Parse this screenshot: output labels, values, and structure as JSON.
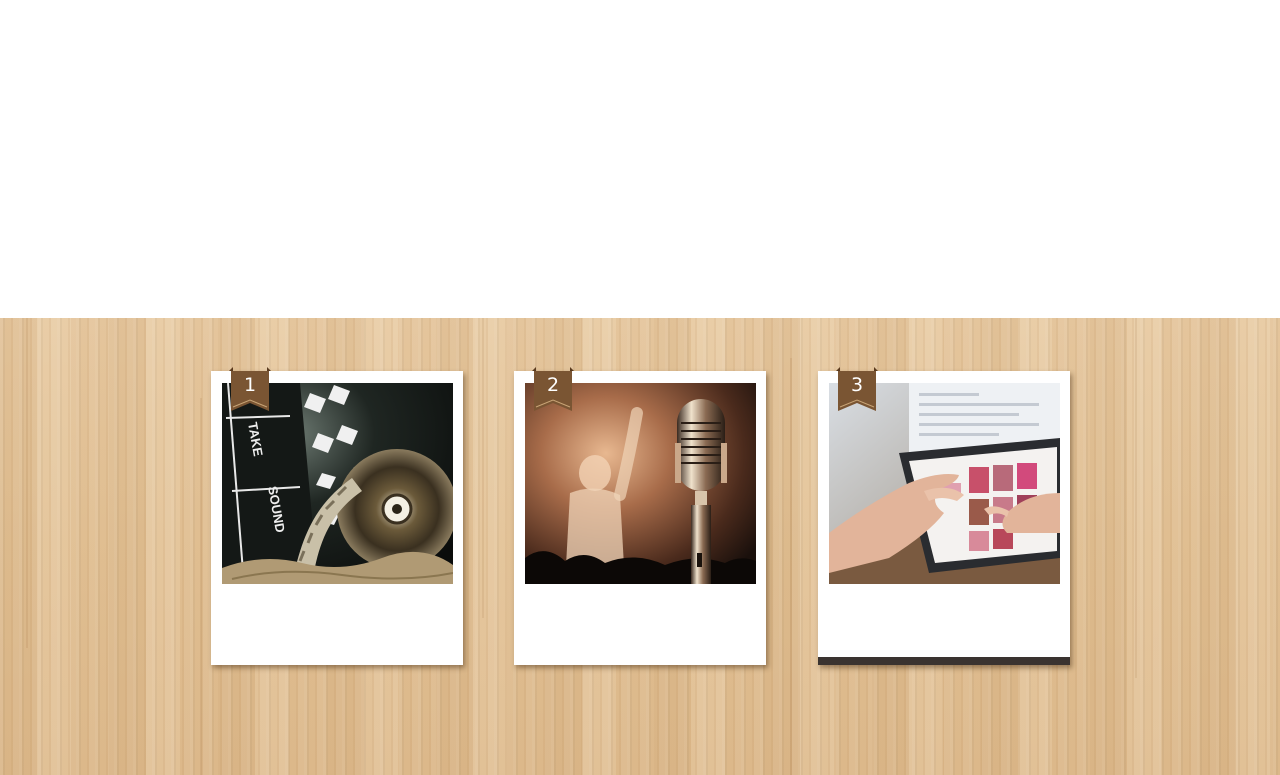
{
  "gallery": {
    "cards": [
      {
        "number": "1",
        "photo": "film-clapperboard-and-reel",
        "active": false
      },
      {
        "number": "2",
        "photo": "vintage-microphone-and-concert",
        "active": false
      },
      {
        "number": "3",
        "photo": "hands-on-tablet-shopping",
        "active": true
      }
    ]
  },
  "colors": {
    "ribbon": "#7a5533",
    "ribbon_dark": "#5a3a1e",
    "active_bar": "#3a3330",
    "wood": "#e3c49a"
  },
  "clapperboard_text": {
    "take": "TAKE",
    "sound": "SOUND"
  }
}
